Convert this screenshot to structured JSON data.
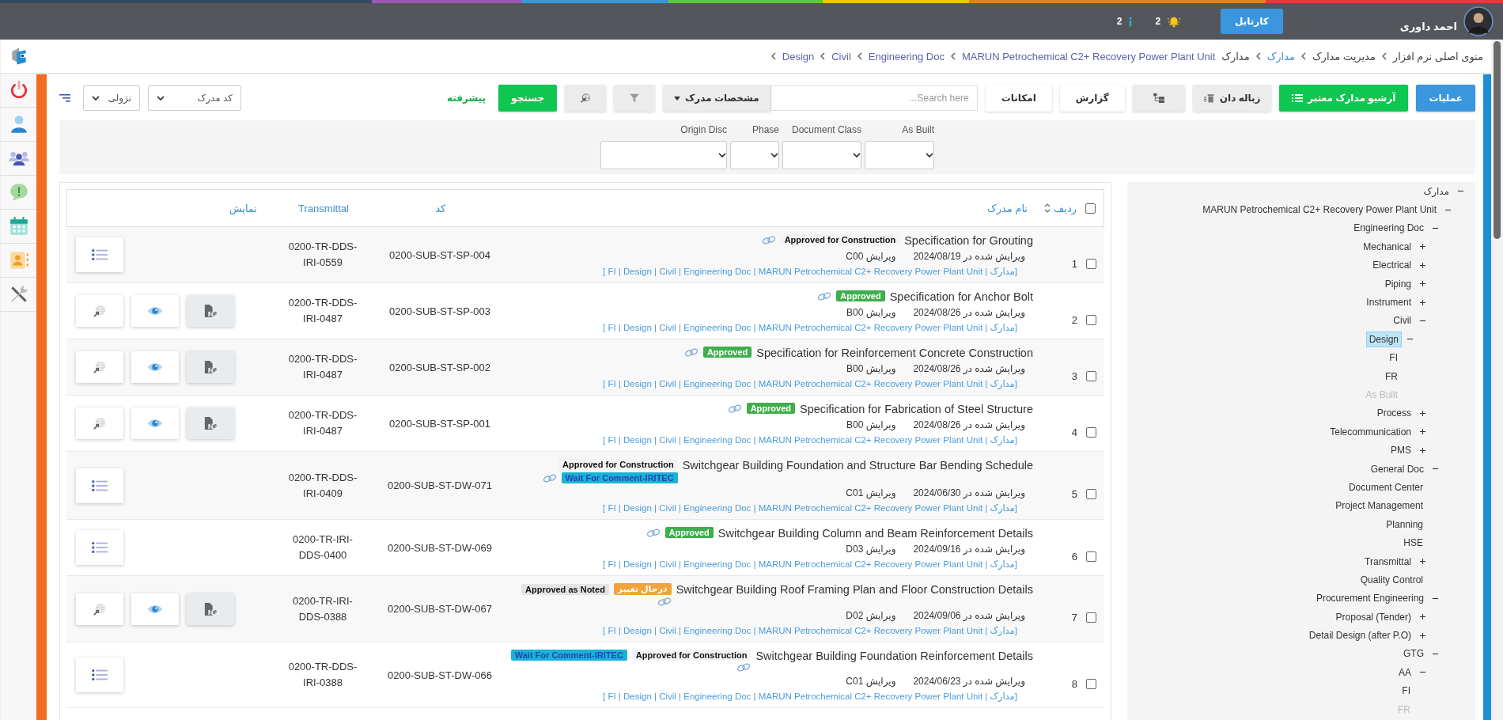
{
  "header": {
    "user_name": "احمد داوری",
    "cartable_button": "کارتابل",
    "alerts_count": "2",
    "info_count": "2"
  },
  "breadcrumb": [
    {
      "label": "منوی اصلی نرم افزار",
      "kind": "plain",
      "chevron": true
    },
    {
      "label": "مدیریت مدارک",
      "kind": "plain",
      "chevron": true
    },
    {
      "label": "مدارک",
      "kind": "link",
      "chevron": true
    },
    {
      "label": "مدارک",
      "kind": "plain",
      "chevron": false
    },
    {
      "label": "MARUN Petrochemical C2+ Recovery Power Plant Unit",
      "kind": "path",
      "chevron": true
    },
    {
      "label": "Engineering Doc",
      "kind": "path",
      "chevron": true
    },
    {
      "label": "Civil",
      "kind": "path",
      "chevron": true
    },
    {
      "label": "Design",
      "kind": "path",
      "chevron": true
    }
  ],
  "toolbar": {
    "operations_button": "عملیات",
    "archive_button": "آرشیو مدارک معتبر",
    "trash_button": "زباله دان",
    "report_button": "گزارش",
    "features_button": "امکانات",
    "search": {
      "placeholder": "Search here..."
    },
    "properties_dropdown": "مشخصات مدرک",
    "search_button": "جستجو",
    "advanced_link": "پیشرفته",
    "sort_field_select": "کد مدرک",
    "sort_order_select": "نزولی"
  },
  "filters": [
    {
      "label": "As Built"
    },
    {
      "label": "Document Class"
    },
    {
      "label": "Phase"
    },
    {
      "label": "Origin Disc"
    }
  ],
  "table": {
    "select_all_checked": false,
    "columns": [
      "ردیف",
      "نام مدرک",
      "کد",
      "Transmittal",
      "نمایش"
    ],
    "rows": [
      {
        "number": "1",
        "checked": false,
        "title": "Specification for Grouting",
        "badges": [
          {
            "text": "Approved for Construction",
            "kind": "plain"
          }
        ],
        "edited": "ویرایش شده در 2024/08/19",
        "revision": "ویرایش C00",
        "path": "[ FI | Design | Civil | Engineering Doc | MARUN Petrochemical C2+ Recovery Power Plant Unit | مدارک]",
        "code": "0200-SUB-ST-SP-004",
        "transmittal": "0200-TR-DDS-IRI-0559",
        "actions": [
          {
            "kind": "list"
          }
        ]
      },
      {
        "number": "2",
        "checked": false,
        "title": "Specification for Anchor Bolt",
        "badges": [
          {
            "text": "Approved",
            "kind": "success"
          }
        ],
        "edited": "ویرایش شده در 2024/08/26",
        "revision": "ویرایش B00",
        "path": "[ FI | Design | Civil | Engineering Doc | MARUN Petrochemical C2+ Recovery Power Plant Unit | مدارک]",
        "code": "0200-SUB-ST-SP-003",
        "transmittal": "0200-TR-DDS-IRI-0487",
        "actions": [
          {
            "kind": "zip"
          },
          {
            "kind": "eye"
          },
          {
            "kind": "globe"
          }
        ]
      },
      {
        "number": "3",
        "checked": false,
        "title": "Specification for Reinforcement Concrete Construction",
        "badges": [
          {
            "text": "Approved",
            "kind": "success"
          }
        ],
        "edited": "ویرایش شده در 2024/08/26",
        "revision": "ویرایش B00",
        "path": "[ FI | Design | Civil | Engineering Doc | MARUN Petrochemical C2+ Recovery Power Plant Unit | مدارک]",
        "code": "0200-SUB-ST-SP-002",
        "transmittal": "0200-TR-DDS-IRI-0487",
        "actions": [
          {
            "kind": "zip"
          },
          {
            "kind": "eye"
          },
          {
            "kind": "globe"
          }
        ]
      },
      {
        "number": "4",
        "checked": false,
        "title": "Specification for Fabrication of Steel Structure",
        "badges": [
          {
            "text": "Approved",
            "kind": "success"
          }
        ],
        "edited": "ویرایش شده در 2024/08/26",
        "revision": "ویرایش B00",
        "path": "[ FI | Design | Civil | Engineering Doc | MARUN Petrochemical C2+ Recovery Power Plant Unit | مدارک]",
        "code": "0200-SUB-ST-SP-001",
        "transmittal": "0200-TR-DDS-IRI-0487",
        "actions": [
          {
            "kind": "zip"
          },
          {
            "kind": "eye"
          },
          {
            "kind": "globe"
          }
        ]
      },
      {
        "number": "5",
        "checked": false,
        "title": "Switchgear Building Foundation and Structure Bar Bending Schedule",
        "badges": [
          {
            "text": "Approved for Construction",
            "kind": "plain"
          },
          {
            "text": "Wait For Comment-IRITEC",
            "kind": "info"
          }
        ],
        "edited": "ویرایش شده در 2024/06/30",
        "revision": "ویرایش C01",
        "path": "[ FI | Design | Civil | Engineering Doc | MARUN Petrochemical C2+ Recovery Power Plant Unit | مدارک]",
        "code": "0200-SUB-ST-DW-071",
        "transmittal": "0200-TR-DDS-IRI-0409",
        "actions": [
          {
            "kind": "list"
          }
        ]
      },
      {
        "number": "6",
        "checked": false,
        "title": "Switchgear Building Column and Beam Reinforcement Details",
        "badges": [
          {
            "text": "Approved",
            "kind": "success"
          }
        ],
        "edited": "ویرایش شده در 2024/09/16",
        "revision": "ویرایش D03",
        "path": "[ FI | Design | Civil | Engineering Doc | MARUN Petrochemical C2+ Recovery Power Plant Unit | مدارک]",
        "code": "0200-SUB-ST-DW-069",
        "transmittal": "0200-TR-IRI-DDS-0400",
        "actions": [
          {
            "kind": "list"
          }
        ]
      },
      {
        "number": "7",
        "checked": false,
        "title": "Switchgear Building Roof Framing Plan and Floor Construction Details",
        "badges": [
          {
            "text": "درحال تغییر",
            "kind": "warning"
          },
          {
            "text": "Approved as Noted",
            "kind": "neutral"
          }
        ],
        "edited": "ویرایش شده در 2024/09/06",
        "revision": "ویرایش D02",
        "path": "[ FI | Design | Civil | Engineering Doc | MARUN Petrochemical C2+ Recovery Power Plant Unit | مدارک]",
        "code": "0200-SUB-ST-DW-067",
        "transmittal": "0200-TR-IRI-DDS-0388",
        "actions": [
          {
            "kind": "zip"
          },
          {
            "kind": "eye"
          },
          {
            "kind": "globe"
          }
        ]
      },
      {
        "number": "8",
        "checked": false,
        "title": "Switchgear Building Foundation Reinforcement Details",
        "badges": [
          {
            "text": "Approved for Construction",
            "kind": "plain"
          },
          {
            "text": "Wait For Comment-IRITEC",
            "kind": "info"
          }
        ],
        "edited": "ویرایش شده در 2024/06/23",
        "revision": "ویرایش C01",
        "path": "[ FI | Design | Civil | Engineering Doc | MARUN Petrochemical C2+ Recovery Power Plant Unit | مدارک]",
        "code": "0200-SUB-ST-DW-066",
        "transmittal": "0200-TR-DDS-IRI-0388",
        "actions": [
          {
            "kind": "list"
          }
        ]
      }
    ]
  },
  "tree": [
    {
      "label": "مدارک",
      "expanded": true,
      "selected": false,
      "disabled": false,
      "children": [
        {
          "label": "MARUN Petrochemical C2+ Recovery Power Plant Unit",
          "expanded": true,
          "selected": false,
          "disabled": false,
          "children": [
            {
              "label": "Engineering Doc",
              "expanded": true,
              "selected": false,
              "disabled": false,
              "children": [
                {
                  "label": "Mechanical",
                  "expanded": false,
                  "selected": false,
                  "disabled": false
                },
                {
                  "label": "Electrical",
                  "expanded": false,
                  "selected": false,
                  "disabled": false
                },
                {
                  "label": "Piping",
                  "expanded": false,
                  "selected": false,
                  "disabled": false
                },
                {
                  "label": "Instrument",
                  "expanded": false,
                  "selected": false,
                  "disabled": false
                },
                {
                  "label": "Civil",
                  "expanded": true,
                  "selected": false,
                  "disabled": false,
                  "children": [
                    {
                      "label": "Design",
                      "expanded": true,
                      "selected": true,
                      "disabled": false,
                      "children": [
                        {
                          "label": "FI",
                          "selected": false,
                          "disabled": false
                        },
                        {
                          "label": "FR",
                          "selected": false,
                          "disabled": false
                        },
                        {
                          "label": "As Built",
                          "selected": false,
                          "disabled": true
                        }
                      ]
                    }
                  ]
                },
                {
                  "label": "Process",
                  "expanded": false,
                  "selected": false,
                  "disabled": false
                },
                {
                  "label": "Telecommunication",
                  "expanded": false,
                  "selected": false,
                  "disabled": false
                },
                {
                  "label": "PMS",
                  "expanded": false,
                  "selected": false,
                  "disabled": false
                }
              ]
            },
            {
              "label": "General Doc",
              "expanded": true,
              "selected": false,
              "disabled": false,
              "children": [
                {
                  "label": "Document Center",
                  "selected": false,
                  "disabled": false
                },
                {
                  "label": "Project Management",
                  "selected": false,
                  "disabled": false
                },
                {
                  "label": "Planning",
                  "selected": false,
                  "disabled": false
                },
                {
                  "label": "HSE",
                  "selected": false,
                  "disabled": false
                },
                {
                  "label": "Transmittal",
                  "expanded": false,
                  "selected": false,
                  "disabled": false
                },
                {
                  "label": "Quality Control",
                  "selected": false,
                  "disabled": false
                }
              ]
            },
            {
              "label": "Procurement Engineering",
              "expanded": true,
              "selected": false,
              "disabled": false,
              "children": [
                {
                  "label": "Proposal (Tender)",
                  "expanded": false,
                  "selected": false,
                  "disabled": false
                },
                {
                  "label": "Detail Design (after P.O)",
                  "expanded": false,
                  "selected": false,
                  "disabled": false
                }
              ]
            },
            {
              "label": "GTG",
              "expanded": true,
              "selected": false,
              "disabled": false,
              "children": [
                {
                  "label": "AA",
                  "expanded": true,
                  "selected": false,
                  "disabled": false,
                  "children": [
                    {
                      "label": "FI",
                      "selected": false,
                      "disabled": false
                    },
                    {
                      "label": "FR",
                      "selected": false,
                      "disabled": true
                    }
                  ]
                }
              ]
            }
          ]
        }
      ]
    }
  ]
}
